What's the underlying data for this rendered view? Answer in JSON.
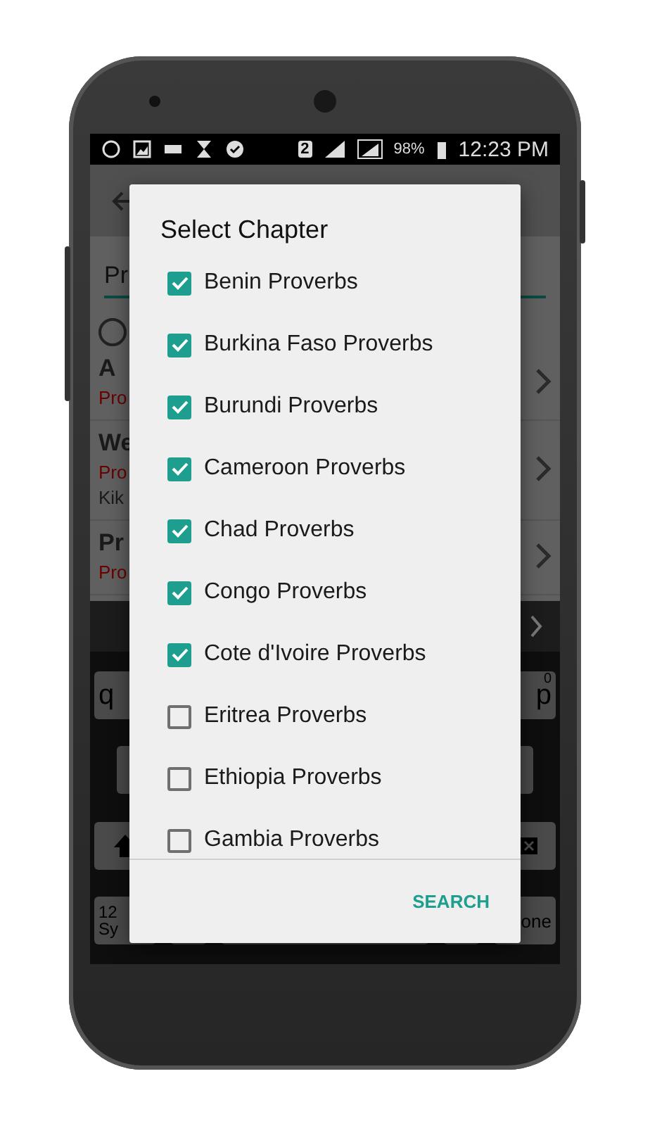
{
  "status_bar": {
    "sim": "2",
    "battery": "98%",
    "time": "12:23 PM"
  },
  "background_app": {
    "search_value": "Pr",
    "radio": {
      "selected": false
    },
    "results": [
      {
        "title": "A",
        "subtitle": "Pro"
      },
      {
        "title": "We",
        "subtitle": "Pro",
        "extra": "Kik"
      },
      {
        "title": "Pr",
        "subtitle": "Pro"
      }
    ],
    "keyboard": {
      "row_1": [
        {
          "key": "q"
        },
        {
          "key": "p",
          "hint": "0"
        }
      ],
      "symbols_key": [
        "12",
        "Sy"
      ],
      "done_key": "one"
    }
  },
  "dialog": {
    "title": "Select Chapter",
    "chapters": [
      {
        "label": "Benin Proverbs",
        "checked": true
      },
      {
        "label": "Burkina Faso Proverbs",
        "checked": true
      },
      {
        "label": "Burundi Proverbs",
        "checked": true
      },
      {
        "label": "Cameroon Proverbs",
        "checked": true
      },
      {
        "label": "Chad Proverbs",
        "checked": true
      },
      {
        "label": "Congo Proverbs",
        "checked": true
      },
      {
        "label": "Cote d'Ivoire Proverbs",
        "checked": true
      },
      {
        "label": "Eritrea Proverbs",
        "checked": false
      },
      {
        "label": "Ethiopia Proverbs",
        "checked": false
      },
      {
        "label": "Gambia Proverbs",
        "checked": false
      }
    ],
    "button": "SEARCH"
  }
}
